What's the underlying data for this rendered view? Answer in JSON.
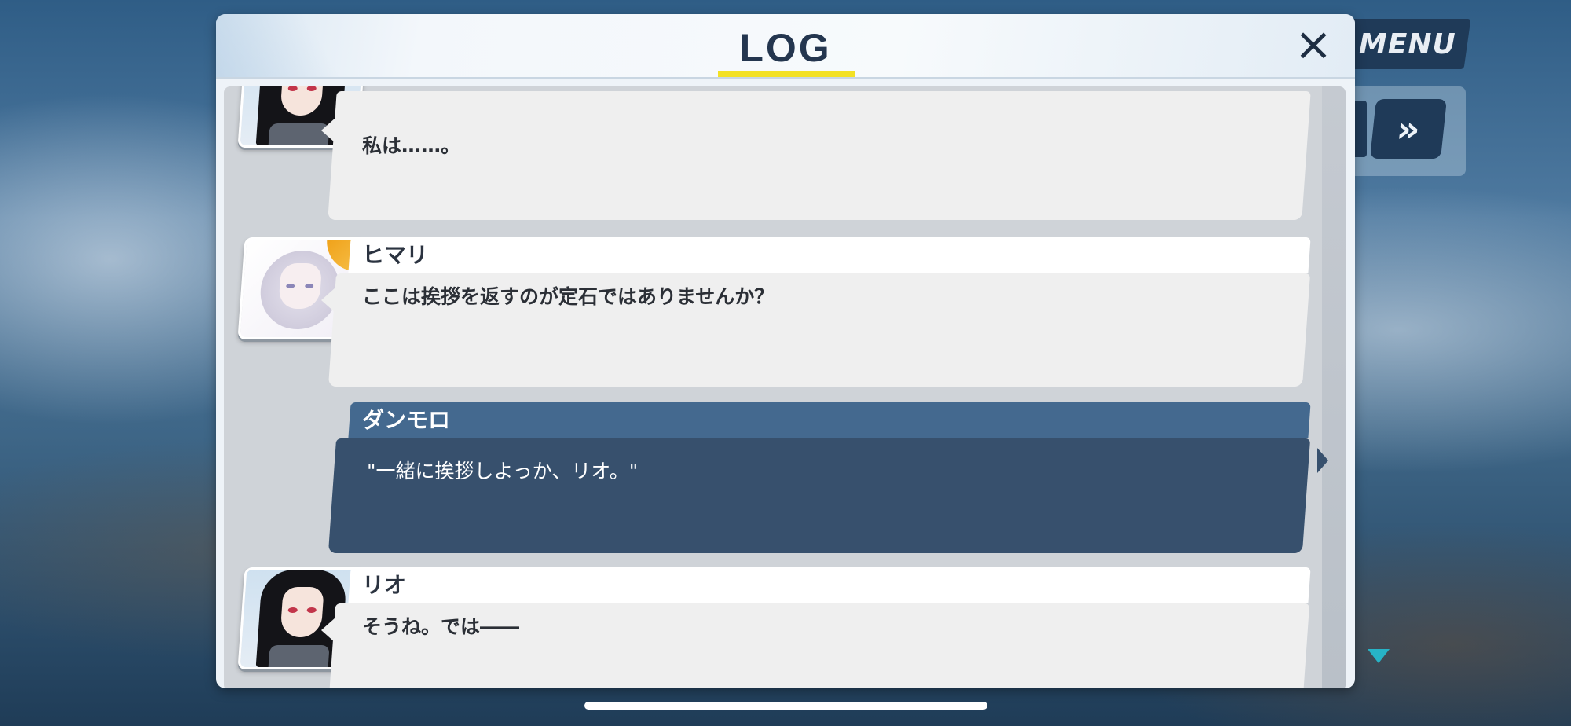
{
  "hud": {
    "menu_label": "MENU",
    "skip_icon": "fast-forward-icon"
  },
  "log": {
    "title": "LOG",
    "close_icon": "×",
    "entries": [
      {
        "speaker": "",
        "message": "私は……。",
        "avatar": "rio-portrait"
      },
      {
        "speaker": "ヒマリ",
        "message": "ここは挨拶を返すのが定石ではありませんか？",
        "avatar": "himari-portrait"
      },
      {
        "speaker": "ダンモロ",
        "message": "\"一緒に挨拶しよっか、リオ。\"",
        "avatar": ""
      },
      {
        "speaker": "リオ",
        "message": "そうね。では――",
        "avatar": "rio-portrait"
      }
    ]
  },
  "colors": {
    "accent_underline": "#f3e125",
    "self_name_bar": "#44698f",
    "self_bubble": "#37506d",
    "panel_title": "#24364f"
  }
}
